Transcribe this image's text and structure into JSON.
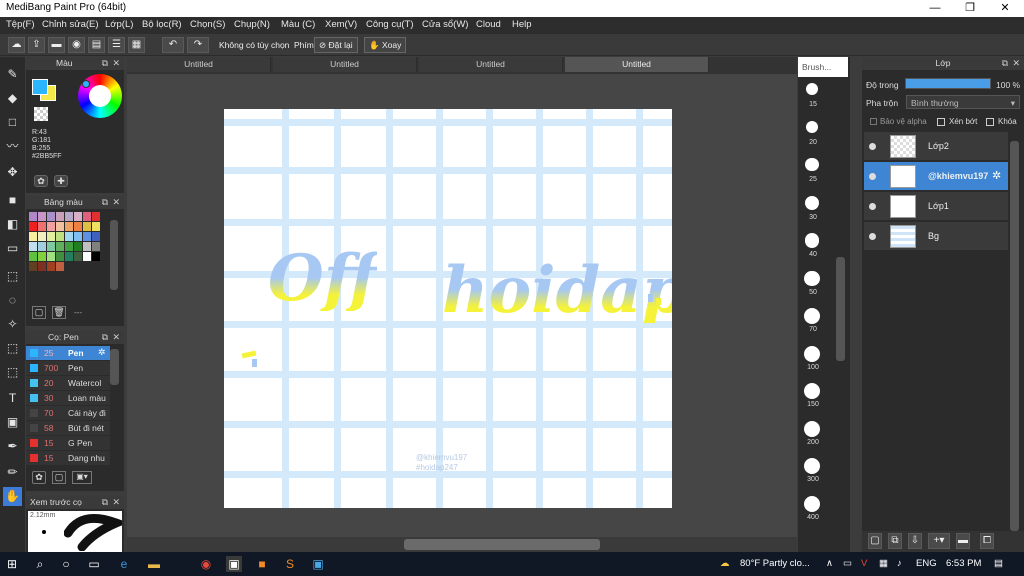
{
  "window": {
    "title": "MediBang Paint Pro (64bit)",
    "controls": [
      "—",
      "❐",
      "✕"
    ]
  },
  "menu": [
    "Tệp(F)",
    "Chỉnh sửa(E)",
    "Lớp(L)",
    "Bộ lọc(R)",
    "Chọn(S)",
    "Chụp(N)",
    "Màu (C)",
    "Xem(V)",
    "Công cụ(T)",
    "Cửa sổ(W)",
    "Cloud",
    "Help"
  ],
  "toolbar": {
    "no_option": "Không có tùy chọn",
    "key_label": "Phím",
    "reset": "Đặt lại",
    "rotate": "Xoay"
  },
  "color_panel": {
    "title": "Màu",
    "r": "R:43",
    "g": "G:181",
    "b": "B:255",
    "hex": "#2BB5FF",
    "fg": "#2bb5ff",
    "bg": "#f5e84a"
  },
  "palette_panel": {
    "title": "Bảng màu",
    "dash": "---"
  },
  "brush_panel": {
    "title": "Cọ: Pen",
    "items": [
      {
        "size": "25",
        "name": "Pen",
        "color": "#2bb5ff",
        "selected": true
      },
      {
        "size": "700",
        "name": "Pen",
        "color": "#2bb5ff",
        "selected": false
      },
      {
        "size": "20",
        "name": "Watercol",
        "color": "#45c1f0",
        "selected": false
      },
      {
        "size": "30",
        "name": "Loan màu",
        "color": "#45c1f0",
        "selected": false
      },
      {
        "size": "70",
        "name": "Cái này đi",
        "color": "#444444",
        "selected": false
      },
      {
        "size": "58",
        "name": "Bút đi nét",
        "color": "#444444",
        "selected": false
      },
      {
        "size": "15",
        "name": "G Pen",
        "color": "#e53030",
        "selected": false
      },
      {
        "size": "15",
        "name": "Dang nhu",
        "color": "#e53030",
        "selected": false
      }
    ]
  },
  "preview_panel": {
    "title": "Xem trước cọ",
    "size": "2.12mm"
  },
  "canvas_tabs": [
    "Untitled",
    "Untitled",
    "Untitled",
    "Untitled"
  ],
  "canvas": {
    "word1": "Off",
    "word2": "hoidap",
    "wm1": "@khiemvu197",
    "wm2": "#hoidap247"
  },
  "brush_sizes": {
    "header": "Brush...",
    "sizes": [
      "15",
      "20",
      "25",
      "30",
      "40",
      "50",
      "70",
      "100",
      "150",
      "200",
      "300",
      "400"
    ]
  },
  "layer_panel": {
    "title": "Lớp",
    "opacity_label": "Độ trong",
    "opacity_value": "100 %",
    "opacity_fraction": 1.0,
    "blend_label": "Pha trộn",
    "blend_value": "Bình thường",
    "protect_alpha": "Bảo vệ alpha",
    "clipping": "Xén bớt",
    "lock": "Khóa",
    "layers": [
      {
        "name": "Lớp2",
        "selected": false
      },
      {
        "name": "@khiemvu197",
        "selected": true
      },
      {
        "name": "Lớp1",
        "selected": false
      },
      {
        "name": "Bg",
        "selected": false
      }
    ]
  },
  "taskbar": {
    "weather": "80°F  Partly clo...",
    "lang": "ENG",
    "time": "6:53 PM"
  }
}
